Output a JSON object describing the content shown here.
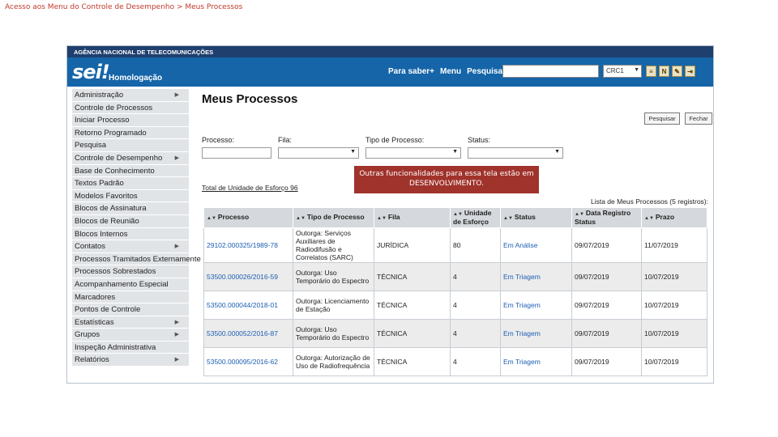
{
  "caption": "Acesso aos Menu do Controle de Desempenho > Meus Processos",
  "header": {
    "agency": "AGÊNCIA NACIONAL DE TELECOMUNICAÇÕES",
    "logo": "sei!",
    "env": "Homologação",
    "nav": [
      "Para saber+",
      "Menu",
      "Pesquisa"
    ],
    "unit": "CRC1",
    "icons": [
      "notification-icon",
      "user-icon",
      "tools-icon",
      "exit-icon"
    ]
  },
  "sidebar": {
    "items": [
      {
        "label": "Administração",
        "sub": true
      },
      {
        "label": "Controle de Processos",
        "sub": false
      },
      {
        "label": "Iniciar Processo",
        "sub": false
      },
      {
        "label": "Retorno Programado",
        "sub": false
      },
      {
        "label": "Pesquisa",
        "sub": false
      },
      {
        "label": "Controle de Desempenho",
        "sub": true
      },
      {
        "label": "Base de Conhecimento",
        "sub": false
      },
      {
        "label": "Textos Padrão",
        "sub": false
      },
      {
        "label": "Modelos Favoritos",
        "sub": false
      },
      {
        "label": "Blocos de Assinatura",
        "sub": false
      },
      {
        "label": "Blocos de Reunião",
        "sub": false
      },
      {
        "label": "Blocos Internos",
        "sub": false
      },
      {
        "label": "Contatos",
        "sub": true
      },
      {
        "label": "Processos Tramitados Externamente",
        "sub": false
      },
      {
        "label": "Processos Sobrestados",
        "sub": false
      },
      {
        "label": "Acompanhamento Especial",
        "sub": false
      },
      {
        "label": "Marcadores",
        "sub": false
      },
      {
        "label": "Pontos de Controle",
        "sub": false
      },
      {
        "label": "Estatísticas",
        "sub": true
      },
      {
        "label": "Grupos",
        "sub": true
      },
      {
        "label": "Inspeção Administrativa",
        "sub": false
      },
      {
        "label": "Relatórios",
        "sub": true
      }
    ]
  },
  "main": {
    "title": "Meus Processos",
    "buttons": {
      "search": "Pesquisar",
      "close": "Fechar"
    },
    "filters": {
      "processo": "Processo:",
      "fila": "Fila:",
      "tipo": "Tipo de Processo:",
      "status": "Status:"
    },
    "notice": "Outras funcionalidades para essa tela estão em DESENVOLVIMENTO.",
    "total": "Total de Unidade de Esforço 96",
    "list_count": "Lista de Meus Processos (5 registros):",
    "table": {
      "headers": [
        "Processo",
        "Tipo de Processo",
        "Fila",
        "Unidade de Esforço",
        "Status",
        "Data Registro Status",
        "Prazo"
      ],
      "rows": [
        [
          "29102.000325/1989-78",
          "Outorga: Serviços Auxiliares de Radiodifusão e Correlatos (SARC)",
          "JURÍDICA",
          "80",
          "Em Análise",
          "09/07/2019",
          "11/07/2019"
        ],
        [
          "53500.000026/2016-59",
          "Outorga: Uso Temporário do Espectro",
          "TÉCNICA",
          "4",
          "Em Triagem",
          "09/07/2019",
          "10/07/2019"
        ],
        [
          "53500.000044/2018-01",
          "Outorga: Licenciamento de Estação",
          "TÉCNICA",
          "4",
          "Em Triagem",
          "09/07/2019",
          "10/07/2019"
        ],
        [
          "53500.000052/2016-87",
          "Outorga: Uso Temporário do Espectro",
          "TÉCNICA",
          "4",
          "Em Triagem",
          "09/07/2019",
          "10/07/2019"
        ],
        [
          "53500.000095/2016-62",
          "Outorga: Autorização de Uso de Radiofrequência",
          "TÉCNICA",
          "4",
          "Em Triagem",
          "09/07/2019",
          "10/07/2019"
        ]
      ]
    }
  }
}
